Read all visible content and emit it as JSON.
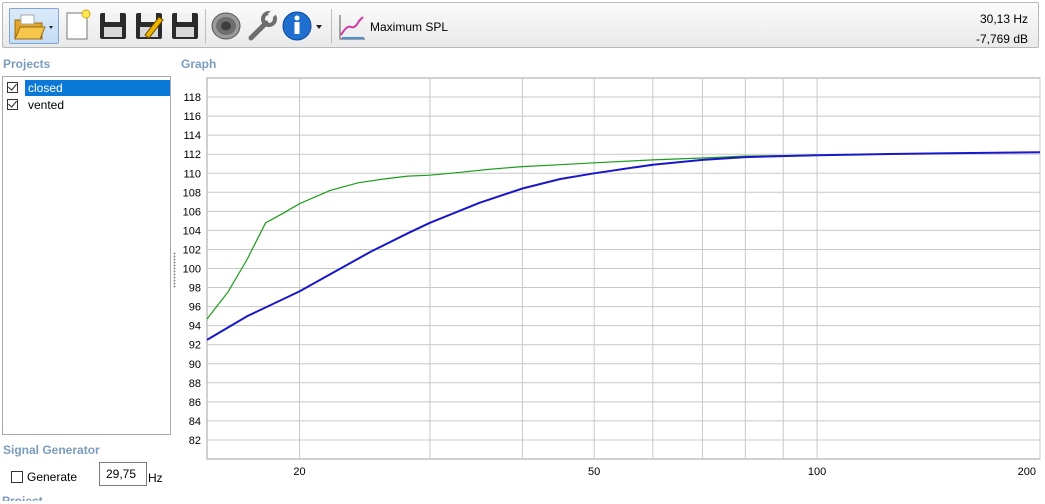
{
  "toolbar": {
    "icons": [
      "open-folder-icon",
      "new-document-icon",
      "save-icon",
      "save-as-icon",
      "save-all-icon",
      "speaker-icon",
      "wrench-icon",
      "info-icon",
      "graph-icon"
    ],
    "mode_label": "Maximum SPL",
    "readout_freq": "30,13 Hz",
    "readout_level": "-7,769 dB"
  },
  "projects": {
    "title": "Projects",
    "items": [
      {
        "label": "closed",
        "checked": true,
        "selected": true
      },
      {
        "label": "vented",
        "checked": true,
        "selected": false
      }
    ]
  },
  "graph": {
    "title": "Graph"
  },
  "signal_generator": {
    "title": "Signal Generator",
    "generate_label": "Generate",
    "frequency_value": "29,75",
    "unit": "Hz"
  },
  "bottom_section": {
    "title": "Project"
  },
  "chart_data": {
    "type": "line",
    "x_scale": "log",
    "xlim": [
      15,
      200
    ],
    "ylim": [
      80,
      120
    ],
    "x_ticks": [
      20,
      50,
      100,
      200
    ],
    "y_ticks": [
      82,
      84,
      86,
      88,
      90,
      92,
      94,
      96,
      98,
      100,
      102,
      104,
      106,
      108,
      110,
      112,
      114,
      116,
      118
    ],
    "grid": true,
    "series": [
      {
        "color": "#1a9e1a",
        "points": [
          [
            15,
            94.7
          ],
          [
            16,
            97.5
          ],
          [
            17,
            101
          ],
          [
            18,
            104.8
          ],
          [
            19,
            105.8
          ],
          [
            20,
            106.8
          ],
          [
            22,
            108.2
          ],
          [
            24,
            109.0
          ],
          [
            26,
            109.4
          ],
          [
            28,
            109.7
          ],
          [
            30,
            109.8
          ],
          [
            33,
            110.1
          ],
          [
            36,
            110.4
          ],
          [
            40,
            110.7
          ],
          [
            45,
            110.9
          ],
          [
            50,
            111.1
          ],
          [
            60,
            111.4
          ],
          [
            70,
            111.6
          ],
          [
            80,
            111.8
          ],
          [
            100,
            111.9
          ],
          [
            120,
            112.0
          ],
          [
            150,
            112.1
          ],
          [
            200,
            112.2
          ]
        ]
      },
      {
        "color": "#1818c8",
        "points": [
          [
            15,
            92.5
          ],
          [
            17,
            95.0
          ],
          [
            20,
            97.6
          ],
          [
            22,
            99.4
          ],
          [
            25,
            101.8
          ],
          [
            28,
            103.7
          ],
          [
            30,
            104.8
          ],
          [
            35,
            106.9
          ],
          [
            40,
            108.4
          ],
          [
            45,
            109.4
          ],
          [
            50,
            110.0
          ],
          [
            60,
            110.9
          ],
          [
            70,
            111.4
          ],
          [
            80,
            111.7
          ],
          [
            100,
            111.9
          ],
          [
            120,
            112.0
          ],
          [
            150,
            112.1
          ],
          [
            200,
            112.2
          ]
        ]
      }
    ]
  }
}
